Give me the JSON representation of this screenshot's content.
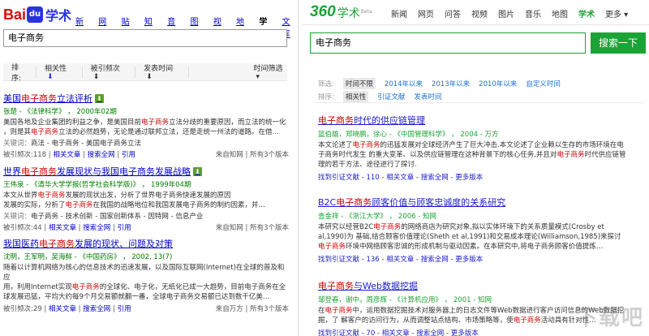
{
  "left": {
    "logo": {
      "bai": "Bai",
      "du": "du",
      "xueshu": "学术"
    },
    "nav": [
      "新闻",
      "网页",
      "贴吧",
      "知道",
      "音乐",
      "图片",
      "视频",
      "地图",
      "学术",
      "文库"
    ],
    "nav_current": "学术",
    "search_value": "电子商务",
    "sortbar": {
      "sort_label": "排序:",
      "relevance": "相关性",
      "cited": "被引频次",
      "pubtime": "发表时间",
      "time_filter": "时间筛选"
    },
    "results": [
      {
        "title_pre": "美国",
        "title_hl": "电子商务",
        "title_post": "立法评析",
        "author": "张楚 - 《法律科学》 ， 2000年02期",
        "snippet_1": "美国各地及企业集团的利益之争，是美国目前",
        "snippet_1_hl": "电子商务",
        "snippet_1_post": "立法分歧的重要原因，而立法的统一化",
        "snippet_2_pre": "，则是其",
        "snippet_2_hl": "电子商务",
        "snippet_2_post": "立法的必然趋势，无论是通过联邦立法，还是走统一州法的道路。在借…",
        "kw_label": "关键词：",
        "kw": "商法 - 电子商务 - 美国电子商务立法",
        "cited": "被引频次:118",
        "links": [
          "相关文章",
          "搜索全网",
          "引用"
        ],
        "source": "来自知网",
        "versions": "所有3个版本"
      },
      {
        "title_pre": "世界",
        "title_hl": "电子商务",
        "title_post": "发展现状与我国电子商务发展战略",
        "author": "王伟泉 - 《清华大学学报(哲学社会科学版)》 ， 1999年04期",
        "snippet_1": "本文从世界",
        "snippet_1_hl": "电子商务",
        "snippet_1_post": "发展的现状出发，分析了世界电子商务快速发展的原因",
        "snippet_2_pre": "发展的实际，分析了",
        "snippet_2_hl": "电子商务",
        "snippet_2_post": "在我国的战略地位和我国发展电子商务的制约因素，并…",
        "kw_label": "关键词：",
        "kw": "电子商务 - 技术创新 - 国家创新体系 - 因特网 - 信息产业",
        "cited": "被引频次:44",
        "links": [
          "相关文章",
          "搜索全网",
          "引用"
        ],
        "source": "来自知网",
        "versions": "所有3个版本"
      },
      {
        "title_pre": "我国医药",
        "title_hl": "电子商务",
        "title_post": "发展的现状、问题及对策",
        "author": "沈明，王军明，吴海鲜 - 《中国药房》 ， 2002, 13(7)",
        "snippet_1": "随着以计算机网络为核心的信息技术的迅速发展，以及国际互联网(Internet)在全球的普及和应",
        "snippet_1_hl": "",
        "snippet_1_post": "",
        "snippet_2_pre": "用，利用Internet实现",
        "snippet_2_hl": "电子商务",
        "snippet_2_post": "的全球化、电子化，无纸化已成一大趋势，目前电子商务在全球发展迅猛，平均大约每9个月交易额就翻一番，全球电子商务交易额已达到数千亿美…",
        "kw_label": "",
        "kw": "",
        "cited": "被引频次:29",
        "links": [
          "相关文章",
          "搜索全网",
          "引用"
        ],
        "source": "来自万方",
        "versions": "所有3个版本"
      }
    ]
  },
  "right": {
    "logo": {
      "num": "360",
      "xueshu": "学术",
      "beta": "Beta"
    },
    "nav": [
      "新闻",
      "网页",
      "问答",
      "视频",
      "图片",
      "音乐",
      "地图",
      "学术",
      "更多 ▾"
    ],
    "nav_current": "学术",
    "search_value": "电子商务",
    "search_button": "搜索一下",
    "filter_label": "筛选:",
    "filter_items": [
      "时间不限",
      "2014年以来",
      "2013年以来",
      "2010年以来",
      "自定义时间"
    ],
    "sort_label": "排序:",
    "sort_items": [
      "相关性",
      "引证文献",
      "发表时间"
    ],
    "results": [
      {
        "title_hl": "电子商务",
        "title_post": "时代的供应链管理",
        "author": "篮伯雄，郑晓鹏，徐心 - 《中国管理科学》 ， 2004 - 万方",
        "snippet_1": "本文论述了",
        "snippet_1_hl": "电子商务",
        "snippet_1_post": "的迅猛发展对全球经济产生了巨大冲击.本文论述了企业赖以生存的市场环境在电子商务时代发生",
        "snippet_2_pre": "的重大变革、以及供应链管理在这种背景下的核心任务,并且对",
        "snippet_2_hl": "电子商务",
        "snippet_2_post": "时代供应链管理的若干方法、途径进行了探讨.",
        "foot_cited": "找到引证文献 - 110",
        "foot_links": [
          "相关文章",
          "搜索全网",
          "更多版本"
        ]
      },
      {
        "title_pre": "B2C",
        "title_hl": "电子商务",
        "title_post": "顾客价值与顾客忠诚度的关系研究",
        "author": "查金祥 - 《浙江大学》 ， 2006 - 知网",
        "snippet_1": "本研究以经营B2C",
        "snippet_1_hl": "电子商务",
        "snippet_1_post": "的网络商店为研究对象,拟以实体环境下的关系质量模式(Crosby et al,1990)为",
        "snippet_2_pre": "基础,结合顾客价值理论(Sheth et al,1991)和交易成本理论(Williamson,1985)来探讨",
        "snippet_2_hl": "电子商务",
        "snippet_2_post": "环境中网络顾客忠诚的形成机制与驱动因素。在本研究中,将电子商务顾客价值提炼…",
        "foot_cited": "找到引证文献 - 136",
        "foot_links": [
          "相关文章",
          "搜索全网",
          "更多版本"
        ]
      },
      {
        "title_hl": "电子商务",
        "title_post": "与Web数据挖掘",
        "author": "邹登春，谢中，周彦辉 - 《计算机应用》 ， 2001 - 知网",
        "snippet_1": "在",
        "snippet_1_hl": "电子商务",
        "snippet_1_post": "中，运用数据挖掘技术对服务器上的日志文件等Web数据进行客户访问信息的Web数据挖掘，了",
        "snippet_2_pre": "解客户的访问行为，从而调整站点结构、市场策略等，使",
        "snippet_2_hl": "电子商务",
        "snippet_2_post": "活动具有针对性…",
        "foot_cited": "找到引证文献 - 70",
        "foot_links": [
          "相关文章",
          "搜索全网",
          "更多版本"
        ]
      }
    ]
  },
  "watermark": "下载吧",
  "colors": {
    "baidu_red": "#e10602",
    "baidu_blue": "#2932e1",
    "so_green": "#1ba336",
    "highlight": "#cc0000"
  }
}
